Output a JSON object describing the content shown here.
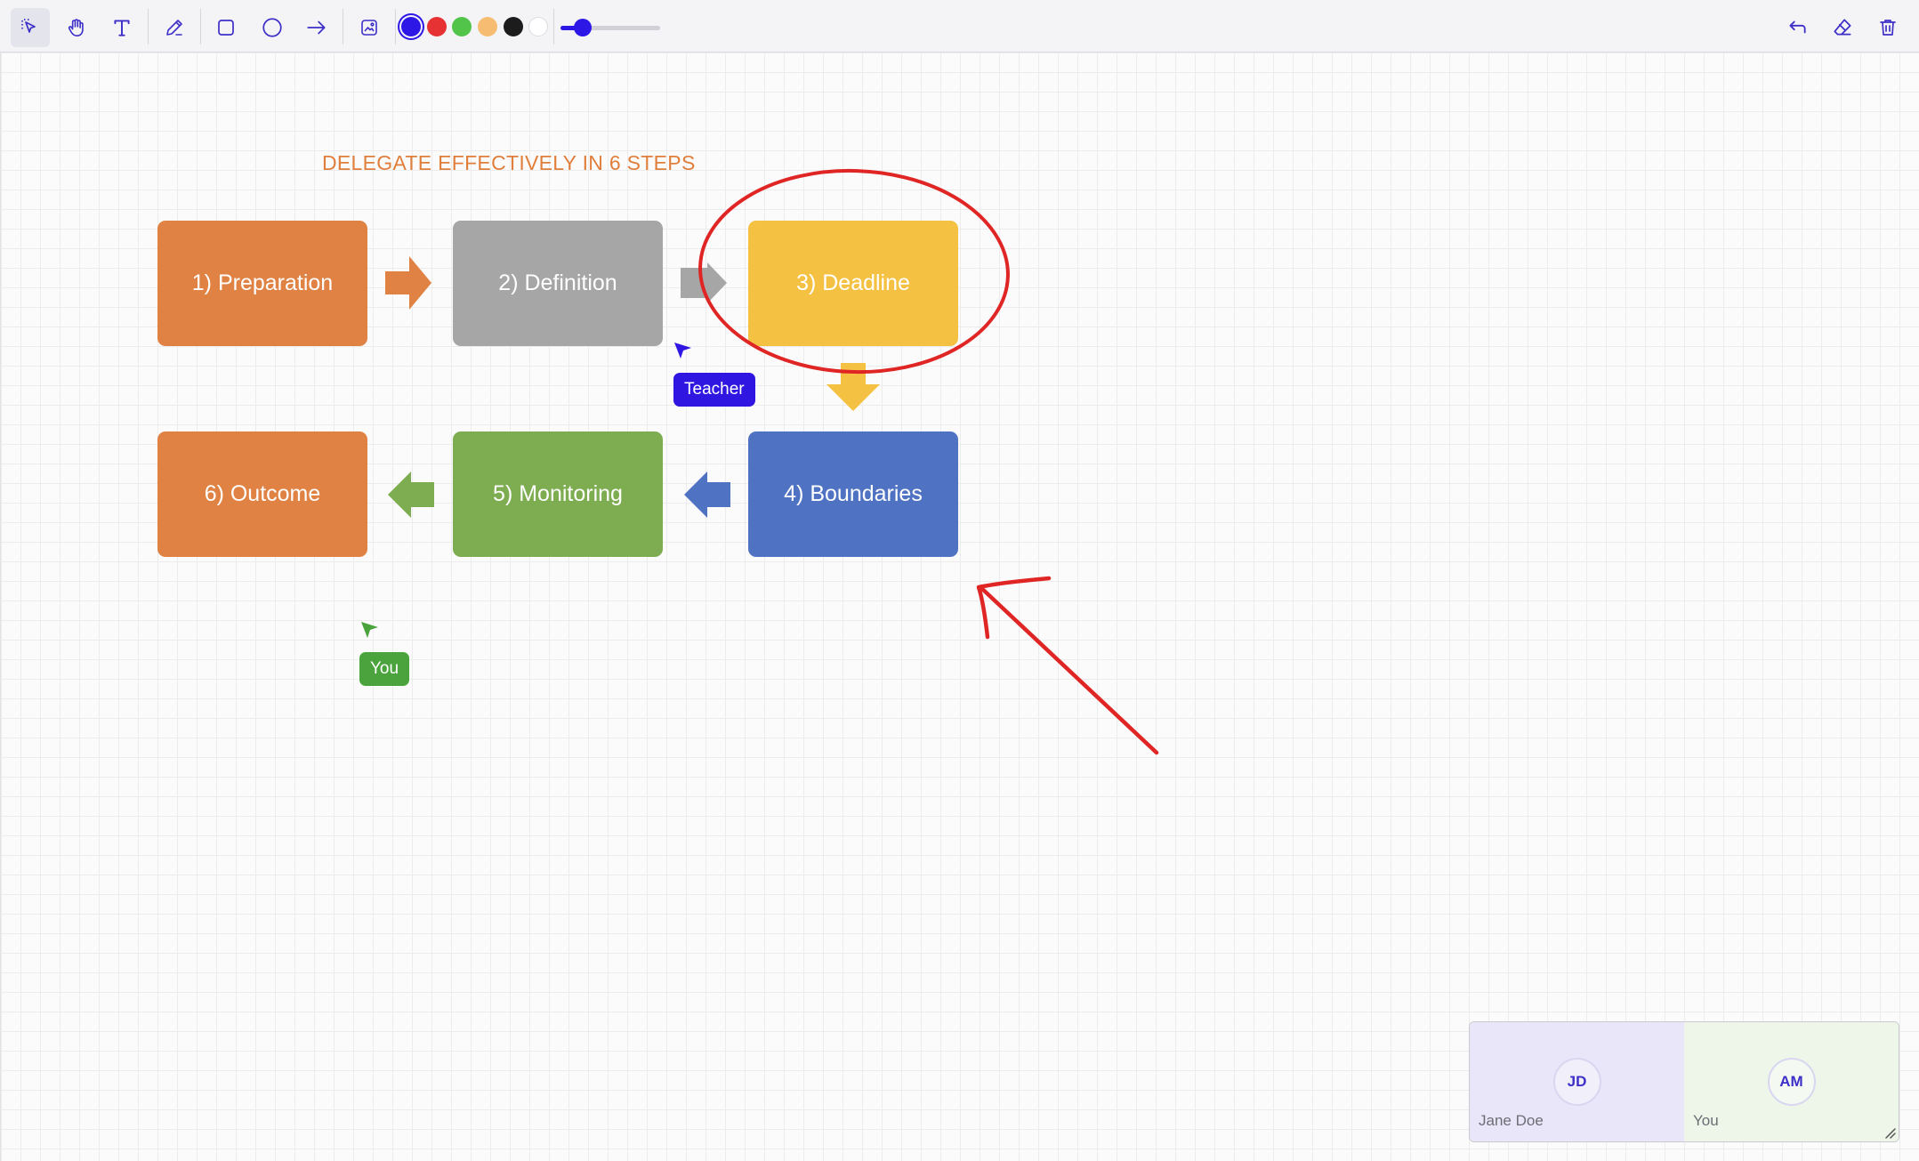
{
  "toolbar": {
    "tools": [
      {
        "name": "select-tool",
        "icon": "select-cursor-icon",
        "active": true
      },
      {
        "name": "pan-tool",
        "icon": "hand-icon"
      },
      {
        "name": "text-tool",
        "icon": "text-icon"
      },
      {
        "name": "pen-tool",
        "icon": "pencil-icon"
      },
      {
        "name": "rectangle-tool",
        "icon": "rectangle-icon"
      },
      {
        "name": "ellipse-tool",
        "icon": "circle-icon"
      },
      {
        "name": "arrow-tool",
        "icon": "arrow-right-icon"
      },
      {
        "name": "image-tool",
        "icon": "image-icon"
      }
    ],
    "colors": [
      "#2c17e6",
      "#e63232",
      "#52c44a",
      "#f6bd72",
      "#1c1c1c",
      "#ffffff"
    ],
    "selected_color": "#2c17e6",
    "stroke_width_fraction": 0.15,
    "actions": [
      {
        "name": "undo-button",
        "icon": "undo-icon"
      },
      {
        "name": "eraser-button",
        "icon": "eraser-icon"
      },
      {
        "name": "delete-button",
        "icon": "trash-icon"
      }
    ]
  },
  "board": {
    "heading": "DELEGATE EFFECTIVELY IN 6 STEPS",
    "heading_color": "#e07e3c",
    "steps": [
      {
        "label": "1) Preparation",
        "color": "#e08244"
      },
      {
        "label": "2) Definition",
        "color": "#a6a6a6"
      },
      {
        "label": "3) Deadline",
        "color": "#f5c142"
      },
      {
        "label": "4) Boundaries",
        "color": "#4f72c2"
      },
      {
        "label": "5) Monitoring",
        "color": "#7dac51"
      },
      {
        "label": "6) Outcome",
        "color": "#e08244"
      }
    ],
    "annotation_color": "#e02525"
  },
  "cursors": [
    {
      "label": "Teacher",
      "color": "#2f16e0"
    },
    {
      "label": "You",
      "color": "#4aa33c"
    }
  ],
  "participants": [
    {
      "initials": "JD",
      "name": "Jane Doe",
      "bg": "#e8e6f8"
    },
    {
      "initials": "AM",
      "name": "You",
      "bg": "#eef6ea"
    }
  ]
}
